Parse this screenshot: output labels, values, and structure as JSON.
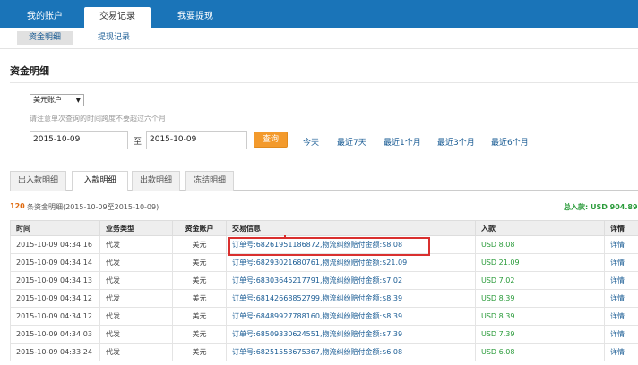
{
  "top_nav": {
    "tabs": [
      {
        "label": "我的账户"
      },
      {
        "label": "交易记录"
      },
      {
        "label": "我要提现"
      }
    ]
  },
  "sub_nav": {
    "items": [
      {
        "label": "资金明细"
      },
      {
        "label": "提现记录"
      }
    ]
  },
  "page_title": "资金明细",
  "filters": {
    "account_select": "美元账户",
    "hint": "请注意单次查询的时间跨度不要超过六个月",
    "start_date": "2015-10-09",
    "to_label": "至",
    "end_date": "2015-10-09",
    "query_button": "查询",
    "quick_links": [
      "今天",
      "最近7天",
      "最近1个月",
      "最近3个月",
      "最近6个月"
    ]
  },
  "detail_tabs": [
    {
      "label": "出入款明细"
    },
    {
      "label": "入款明细"
    },
    {
      "label": "出款明细"
    },
    {
      "label": "冻结明细"
    }
  ],
  "summary": {
    "count": "120",
    "text": "条资金明细(2015-10-09至2015-10-09)",
    "total": "总入款: USD 904.89"
  },
  "table": {
    "headers": [
      "时间",
      "业务类型",
      "资金账户",
      "交易信息",
      "入款",
      "详情"
    ],
    "rows": [
      {
        "time": "2015-10-09 04:34:16",
        "type": "代发",
        "account": "美元",
        "info": "订单号:68261951186872,物流纠纷赔付金额:$8.08",
        "amount": "USD 8.08",
        "detail": "详情"
      },
      {
        "time": "2015-10-09 04:34:14",
        "type": "代发",
        "account": "美元",
        "info": "订单号:68293021680761,物流纠纷赔付金额:$21.09",
        "amount": "USD 21.09",
        "detail": "详情"
      },
      {
        "time": "2015-10-09 04:34:13",
        "type": "代发",
        "account": "美元",
        "info": "订单号:68303645217791,物流纠纷赔付金额:$7.02",
        "amount": "USD 7.02",
        "detail": "详情"
      },
      {
        "time": "2015-10-09 04:34:12",
        "type": "代发",
        "account": "美元",
        "info": "订单号:68142668852799,物流纠纷赔付金额:$8.39",
        "amount": "USD 8.39",
        "detail": "详情"
      },
      {
        "time": "2015-10-09 04:34:12",
        "type": "代发",
        "account": "美元",
        "info": "订单号:68489927788160,物流纠纷赔付金额:$8.39",
        "amount": "USD 8.39",
        "detail": "详情"
      },
      {
        "time": "2015-10-09 04:34:03",
        "type": "代发",
        "account": "美元",
        "info": "订单号:68509330624551,物流纠纷赔付金额:$7.39",
        "amount": "USD 7.39",
        "detail": "详情"
      },
      {
        "time": "2015-10-09 04:33:24",
        "type": "代发",
        "account": "美元",
        "info": "订单号:68251553675367,物流纠纷赔付金额:$6.08",
        "amount": "USD 6.08",
        "detail": "详情"
      }
    ]
  },
  "colors": {
    "nav_blue": "#1a74b8",
    "link_blue": "#1a5c94",
    "income_green": "#2a9b3a",
    "query_orange": "#f39a2c",
    "highlight_red": "#d9302f"
  }
}
